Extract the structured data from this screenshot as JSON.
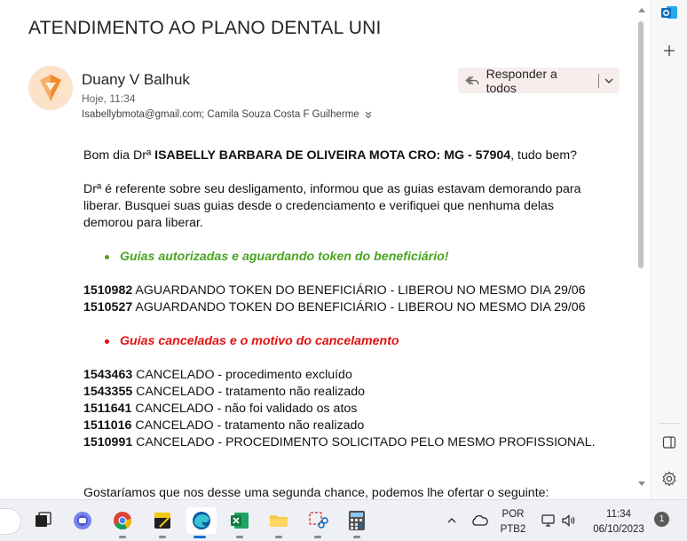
{
  "email": {
    "subject": "ATENDIMENTO AO PLANO DENTAL UNI",
    "sender": "Duany V Balhuk",
    "time": "Hoje, 11:34",
    "recipients": "Isabellybmota@gmail.com; Camila Souza Costa F Guilherme",
    "reply_all_label": "Responder a todos"
  },
  "body": {
    "greeting_pre": "Bom dia Drª ",
    "greeting_name": "ISABELLY BARBARA DE OLIVEIRA MOTA CRO: MG - 57904",
    "greeting_post": ", tudo bem?",
    "para1_line1": "Drª é referente sobre seu desligamento, informou que as guias estavam demorando para",
    "para1_line2": "liberar. Busquei suas guias desde o credenciamento e verifiquei que nenhuma delas",
    "para1_line3": "demorou para liberar.",
    "authorized_heading": "Guias autorizadas e aguardando token do beneficiário!",
    "authorized": [
      {
        "id": "1510982",
        "text": " AGUARDANDO TOKEN DO BENEFICIÁRIO - LIBEROU NO MESMO DIA 29/06"
      },
      {
        "id": "1510527",
        "text": " AGUARDANDO TOKEN DO BENEFICIÁRIO - LIBEROU NO MESMO DIA 29/06"
      }
    ],
    "canceled_heading": "Guias canceladas e o motivo do cancelamento",
    "canceled": [
      {
        "id": "1543463",
        "text": " CANCELADO - procedimento excluído"
      },
      {
        "id": "1543355",
        "text": " CANCELADO - tratamento não realizado"
      },
      {
        "id": "1511641",
        "text": " CANCELADO - não foi validado os atos"
      },
      {
        "id": "1511016",
        "text": " CANCELADO - tratamento não realizado"
      },
      {
        "id": "1510991",
        "text": " CANCELADO - PROCEDIMENTO SOLICITADO PELO MESMO PROFISSIONAL."
      }
    ],
    "closing_partial": "Gostaríamos que nos desse uma segunda chance, podemos lhe ofertar o seguinte:"
  },
  "colors": {
    "green_heading": "#4aa420",
    "red_heading": "#e01010",
    "avatar_bg": "#fbe2c8",
    "outlook_blue": "#0f6cbd"
  },
  "sidebar": {
    "icons": [
      "outlook-icon",
      "add-icon",
      "panel-icon",
      "settings-icon"
    ]
  },
  "taskbar": {
    "apps": [
      "task-view-icon",
      "teams-icon",
      "chrome-icon",
      "sticky-notes-icon",
      "edge-icon",
      "excel-icon",
      "file-explorer-icon",
      "snipping-tool-icon",
      "calculator-icon"
    ],
    "lang_top": "POR",
    "lang_bottom": "PTB2",
    "clock_time": "11:34",
    "clock_date": "06/10/2023",
    "notification_count": "1"
  }
}
